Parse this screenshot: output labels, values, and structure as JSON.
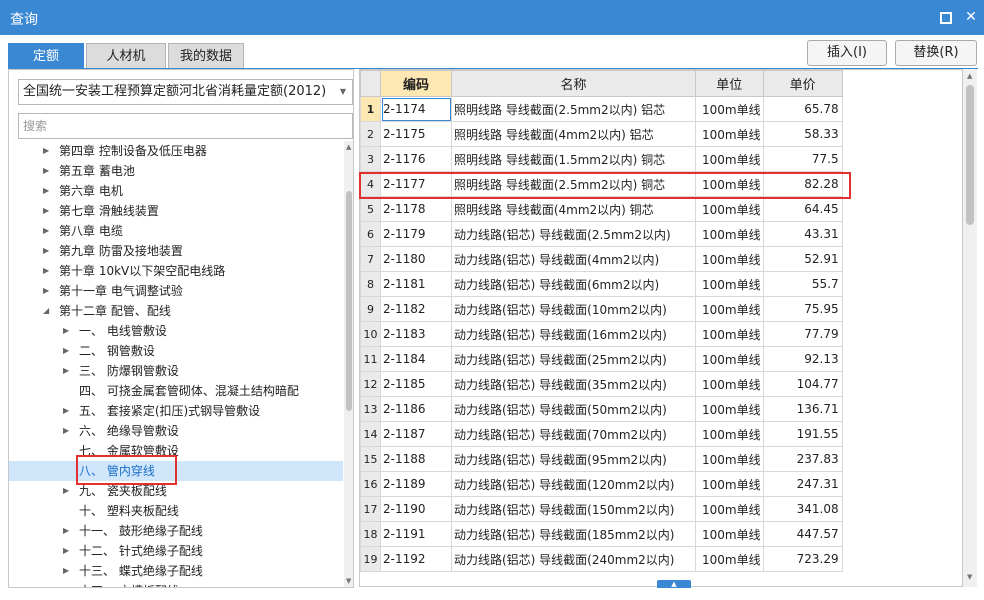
{
  "window": {
    "title": "查询"
  },
  "tabs": [
    {
      "label": "定额",
      "active": true
    },
    {
      "label": "人材机",
      "active": false
    },
    {
      "label": "我的数据",
      "active": false
    }
  ],
  "buttons": {
    "insert": "插入(I)",
    "replace": "替换(R)"
  },
  "left": {
    "library": "全国统一安装工程预算定额河北省消耗量定额(2012)",
    "search_placeholder": "搜索",
    "tree": [
      {
        "label": "第四章 控制设备及低压电器",
        "level": 0,
        "expander": "collapsed"
      },
      {
        "label": "第五章 蓄电池",
        "level": 0,
        "expander": "collapsed"
      },
      {
        "label": "第六章 电机",
        "level": 0,
        "expander": "collapsed"
      },
      {
        "label": "第七章 滑触线装置",
        "level": 0,
        "expander": "collapsed"
      },
      {
        "label": "第八章 电缆",
        "level": 0,
        "expander": "collapsed"
      },
      {
        "label": "第九章 防雷及接地装置",
        "level": 0,
        "expander": "collapsed"
      },
      {
        "label": "第十章 10kV以下架空配电线路",
        "level": 0,
        "expander": "collapsed"
      },
      {
        "label": "第十一章 电气调整试验",
        "level": 0,
        "expander": "collapsed"
      },
      {
        "label": "第十二章 配管、配线",
        "level": 0,
        "expander": "expanded"
      },
      {
        "label": "一、 电线管敷设",
        "level": 1,
        "expander": "collapsed"
      },
      {
        "label": "二、 钢管敷设",
        "level": 1,
        "expander": "collapsed"
      },
      {
        "label": "三、 防爆钢管敷设",
        "level": 1,
        "expander": "collapsed"
      },
      {
        "label": "四、 可挠金属套管砌体、混凝土结构暗配",
        "level": 1,
        "expander": "none"
      },
      {
        "label": "五、 套接紧定(扣压)式钢导管敷设",
        "level": 1,
        "expander": "collapsed"
      },
      {
        "label": "六、 绝缘导管敷设",
        "level": 1,
        "expander": "collapsed"
      },
      {
        "label": "七、 金属软管敷设",
        "level": 1,
        "expander": "none"
      },
      {
        "label": "八、 管内穿线",
        "level": 1,
        "expander": "none",
        "selected": true
      },
      {
        "label": "九、 瓷夹板配线",
        "level": 1,
        "expander": "collapsed"
      },
      {
        "label": "十、 塑料夹板配线",
        "level": 1,
        "expander": "none"
      },
      {
        "label": "十一、 鼓形绝缘子配线",
        "level": 1,
        "expander": "collapsed"
      },
      {
        "label": "十二、 针式绝缘子配线",
        "level": 1,
        "expander": "collapsed"
      },
      {
        "label": "十三、 蝶式绝缘子配线",
        "level": 1,
        "expander": "collapsed"
      },
      {
        "label": "十四、 木槽板配线",
        "level": 1,
        "expander": "collapsed"
      }
    ]
  },
  "grid": {
    "columns": [
      "编码",
      "名称",
      "单位",
      "单价"
    ],
    "rows": [
      {
        "idx": "1",
        "code": "2-1174",
        "name": "照明线路 导线截面(2.5mm2以内) 铝芯",
        "unit": "100m单线",
        "price": "65.78"
      },
      {
        "idx": "2",
        "code": "2-1175",
        "name": "照明线路 导线截面(4mm2以内) 铝芯",
        "unit": "100m单线",
        "price": "58.33"
      },
      {
        "idx": "3",
        "code": "2-1176",
        "name": "照明线路 导线截面(1.5mm2以内) 铜芯",
        "unit": "100m单线",
        "price": "77.5"
      },
      {
        "idx": "4",
        "code": "2-1177",
        "name": "照明线路 导线截面(2.5mm2以内) 铜芯",
        "unit": "100m单线",
        "price": "82.28"
      },
      {
        "idx": "5",
        "code": "2-1178",
        "name": "照明线路 导线截面(4mm2以内) 铜芯",
        "unit": "100m单线",
        "price": "64.45"
      },
      {
        "idx": "6",
        "code": "2-1179",
        "name": "动力线路(铝芯) 导线截面(2.5mm2以内)",
        "unit": "100m单线",
        "price": "43.31"
      },
      {
        "idx": "7",
        "code": "2-1180",
        "name": "动力线路(铝芯) 导线截面(4mm2以内)",
        "unit": "100m单线",
        "price": "52.91"
      },
      {
        "idx": "8",
        "code": "2-1181",
        "name": "动力线路(铝芯) 导线截面(6mm2以内)",
        "unit": "100m单线",
        "price": "55.7"
      },
      {
        "idx": "9",
        "code": "2-1182",
        "name": "动力线路(铝芯) 导线截面(10mm2以内)",
        "unit": "100m单线",
        "price": "75.95"
      },
      {
        "idx": "10",
        "code": "2-1183",
        "name": "动力线路(铝芯) 导线截面(16mm2以内)",
        "unit": "100m单线",
        "price": "77.79"
      },
      {
        "idx": "11",
        "code": "2-1184",
        "name": "动力线路(铝芯) 导线截面(25mm2以内)",
        "unit": "100m单线",
        "price": "92.13"
      },
      {
        "idx": "12",
        "code": "2-1185",
        "name": "动力线路(铝芯) 导线截面(35mm2以内)",
        "unit": "100m单线",
        "price": "104.77"
      },
      {
        "idx": "13",
        "code": "2-1186",
        "name": "动力线路(铝芯) 导线截面(50mm2以内)",
        "unit": "100m单线",
        "price": "136.71"
      },
      {
        "idx": "14",
        "code": "2-1187",
        "name": "动力线路(铝芯) 导线截面(70mm2以内)",
        "unit": "100m单线",
        "price": "191.55"
      },
      {
        "idx": "15",
        "code": "2-1188",
        "name": "动力线路(铝芯) 导线截面(95mm2以内)",
        "unit": "100m单线",
        "price": "237.83"
      },
      {
        "idx": "16",
        "code": "2-1189",
        "name": "动力线路(铝芯) 导线截面(120mm2以内)",
        "unit": "100m单线",
        "price": "247.31"
      },
      {
        "idx": "17",
        "code": "2-1190",
        "name": "动力线路(铝芯) 导线截面(150mm2以内)",
        "unit": "100m单线",
        "price": "341.08"
      },
      {
        "idx": "18",
        "code": "2-1191",
        "name": "动力线路(铝芯) 导线截面(185mm2以内)",
        "unit": "100m单线",
        "price": "447.57"
      },
      {
        "idx": "19",
        "code": "2-1192",
        "name": "动力线路(铝芯) 导线截面(240mm2以内)",
        "unit": "100m单线",
        "price": "723.29"
      }
    ]
  },
  "colors": {
    "accent": "#3a88d4",
    "highlight": "#e03030",
    "header_code": "#fde7b2",
    "selected_bg": "#cfe6fb"
  }
}
